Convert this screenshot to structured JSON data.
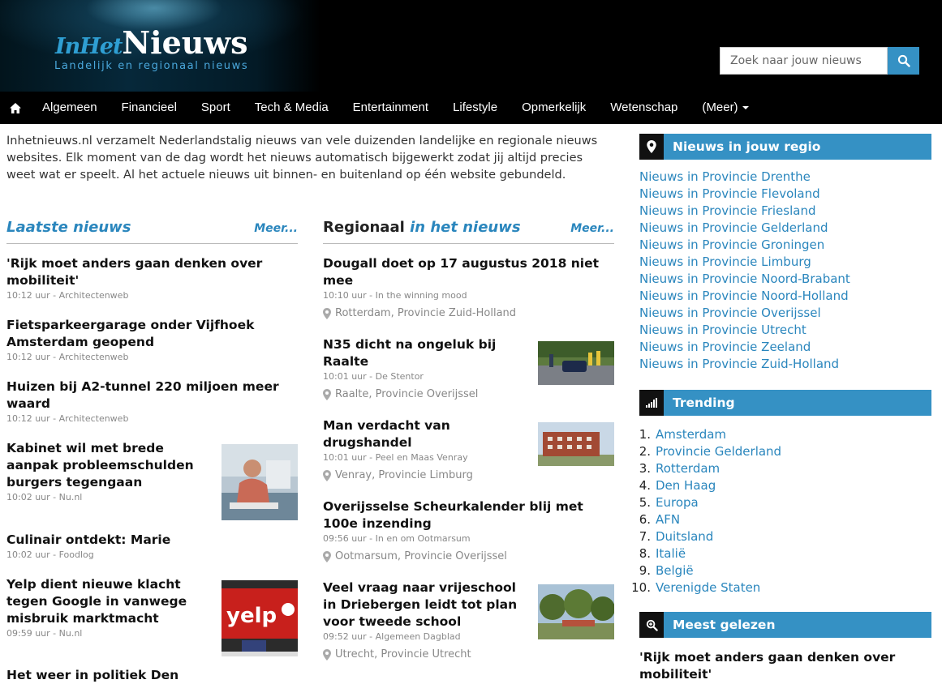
{
  "header": {
    "logo_prefix": "InHet",
    "logo_main": "Nieuws",
    "tagline": "Landelijk en regionaal nieuws",
    "search_placeholder": "Zoek naar jouw nieuws"
  },
  "nav": {
    "items": [
      "Algemeen",
      "Financieel",
      "Sport",
      "Tech & Media",
      "Entertainment",
      "Lifestyle",
      "Opmerkelijk",
      "Wetenschap"
    ],
    "more": "(Meer)"
  },
  "intro": "Inhetnieuws.nl verzamelt Nederlandstalig nieuws van vele duizenden landelijke en regionale nieuws websites. Elk moment van de dag wordt het nieuws automatisch bijgewerkt zodat jij altijd precies weet wat er speelt. Al het actuele nieuws uit binnen- en buitenland op één website gebundeld.",
  "latest": {
    "title": "Laatste nieuws",
    "more": "Meer...",
    "articles": [
      {
        "title": "'Rijk moet anders gaan denken over mobiliteit'",
        "meta": "10:12 uur - Architectenweb"
      },
      {
        "title": "Fietsparkeergarage onder Vijfhoek Amsterdam geopend",
        "meta": "10:12 uur - Architectenweb"
      },
      {
        "title": "Huizen bij A2-tunnel 220 miljoen meer waard",
        "meta": "10:12 uur - Architectenweb"
      },
      {
        "title": "Kabinet wil met brede aanpak probleemschulden burgers tegengaan",
        "meta": "10:02 uur - Nu.nl"
      },
      {
        "title": "Culinair ontdekt: Marie",
        "meta": "10:02 uur - Foodlog"
      },
      {
        "title": "Yelp dient nieuwe klacht tegen Google in vanwege misbruik marktmacht",
        "meta": "09:59 uur - Nu.nl",
        "thumb_text": "yelp"
      },
      {
        "title": "Het weer in politiek Den",
        "meta": ""
      }
    ]
  },
  "regional": {
    "title_plain": "Regionaal",
    "title_blue": "in het nieuws",
    "more": "Meer...",
    "articles": [
      {
        "title": "Dougall doet op 17 augustus 2018 niet mee",
        "meta": "10:10 uur - In the winning mood",
        "location": "Rotterdam, Provincie Zuid-Holland"
      },
      {
        "title": "N35 dicht na ongeluk bij Raalte",
        "meta": "10:01 uur - De Stentor",
        "location": "Raalte, Provincie Overijssel"
      },
      {
        "title": "Man verdacht van drugshandel",
        "meta": "10:01 uur - Peel en Maas Venray",
        "location": "Venray, Provincie Limburg"
      },
      {
        "title": "Overijsselse Scheurkalender blij met 100e inzending",
        "meta": "09:56 uur - In en om Ootmarsum",
        "location": "Ootmarsum, Provincie Overijssel"
      },
      {
        "title": "Veel vraag naar vrijeschool in Driebergen leidt tot plan voor tweede school",
        "meta": "09:52 uur - Algemeen Dagblad",
        "location": "Utrecht, Provincie Utrecht"
      }
    ]
  },
  "sidebar": {
    "regions_title": "Nieuws in jouw regio",
    "regions": [
      "Nieuws in Provincie Drenthe",
      "Nieuws in Provincie Flevoland",
      "Nieuws in Provincie Friesland",
      "Nieuws in Provincie Gelderland",
      "Nieuws in Provincie Groningen",
      "Nieuws in Provincie Limburg",
      "Nieuws in Provincie Noord-Brabant",
      "Nieuws in Provincie Noord-Holland",
      "Nieuws in Provincie Overijssel",
      "Nieuws in Provincie Utrecht",
      "Nieuws in Provincie Zeeland",
      "Nieuws in Provincie Zuid-Holland"
    ],
    "trending_title": "Trending",
    "trending": [
      {
        "num": "1.",
        "label": "Amsterdam"
      },
      {
        "num": "2.",
        "label": "Provincie Gelderland"
      },
      {
        "num": "3.",
        "label": "Rotterdam"
      },
      {
        "num": "4.",
        "label": "Den Haag"
      },
      {
        "num": "5.",
        "label": "Europa"
      },
      {
        "num": "6.",
        "label": "AFN"
      },
      {
        "num": "7.",
        "label": "Duitsland"
      },
      {
        "num": "8.",
        "label": "Italië"
      },
      {
        "num": "9.",
        "label": "België"
      },
      {
        "num": "10.",
        "label": "Verenigde Staten"
      }
    ],
    "most_read_title": "Meest gelezen",
    "most_read": [
      "'Rijk moet anders gaan denken over mobiliteit'"
    ]
  },
  "colors": {
    "accent": "#3591c4",
    "link": "#2a86bd",
    "header_bg": "#000000"
  }
}
